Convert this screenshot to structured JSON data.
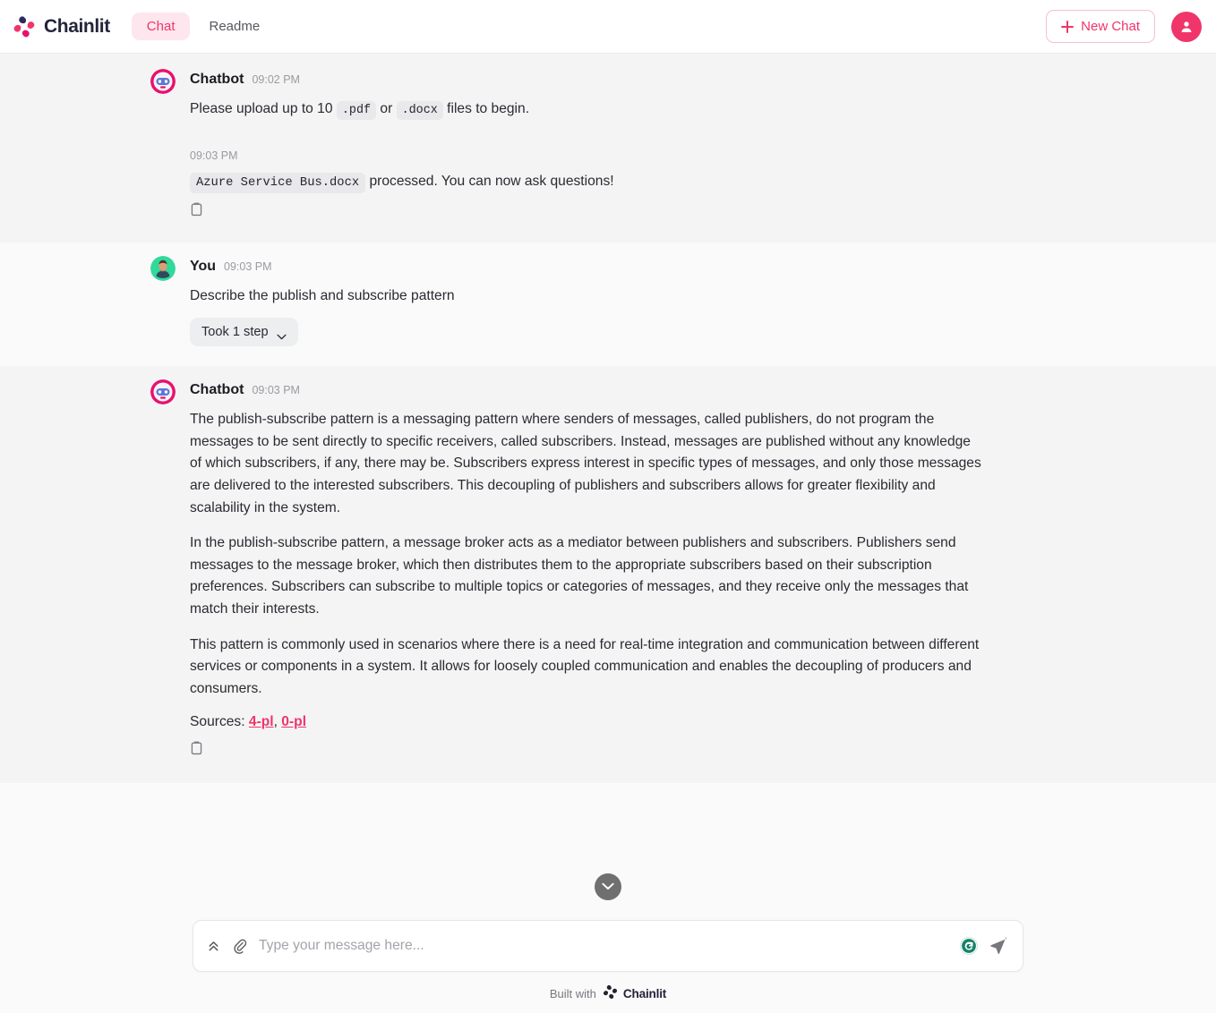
{
  "header": {
    "brand": "Chainlit",
    "brand_mark_icon": "chainlit-logo-icon",
    "nav": [
      {
        "label": "Chat",
        "active": true
      },
      {
        "label": "Readme",
        "active": false
      }
    ],
    "new_chat_label": "New Chat",
    "new_chat_icon": "plus-icon",
    "avatar_icon": "user-avatar-icon",
    "accent_color": "#f0356a",
    "accent_soft_color": "#fde6ee"
  },
  "conversation": {
    "messages": [
      {
        "author": "Chatbot",
        "time": "09:02 PM",
        "avatar_icon": "robot-avatar-icon",
        "text_before": "Please upload up to 10",
        "code_1": ".pdf",
        "text_middle": "or",
        "code_2": ".docx",
        "text_after": "files to begin."
      },
      {
        "sub_time": "09:03 PM",
        "code_file": "Azure Service Bus.docx",
        "text_after": "processed. You can now ask questions!",
        "copy_icon": "copy-icon"
      },
      {
        "author": "You",
        "time": "09:03 PM",
        "avatar_icon": "person-avatar-icon",
        "text": "Describe the publish and subscribe pattern",
        "step_label": "Took 1 step",
        "step_chevron_icon": "chevron-down-icon"
      },
      {
        "author": "Chatbot",
        "time": "09:03 PM",
        "avatar_icon": "robot-avatar-icon",
        "paragraph_1": "The publish-subscribe pattern is a messaging pattern where senders of messages, called publishers, do not program the messages to be sent directly to specific receivers, called subscribers. Instead, messages are published without any knowledge of which subscribers, if any, there may be. Subscribers express interest in specific types of messages, and only those messages are delivered to the interested subscribers. This decoupling of publishers and subscribers allows for greater flexibility and scalability in the system.",
        "paragraph_2": "In the publish-subscribe pattern, a message broker acts as a mediator between publishers and subscribers. Publishers send messages to the message broker, which then distributes them to the appropriate subscribers based on their subscription preferences. Subscribers can subscribe to multiple topics or categories of messages, and they receive only the messages that match their interests.",
        "paragraph_3": "This pattern is commonly used in scenarios where there is a need for real-time integration and communication between different services or components in a system. It allows for loosely coupled communication and enables the decoupling of producers and consumers.",
        "sources_label": "Sources:",
        "sources": [
          "4-pl",
          "0-pl"
        ],
        "sources_separator": ", ",
        "copy_icon": "copy-icon"
      }
    ]
  },
  "composer": {
    "expand_icon": "chevrons-up-icon",
    "attach_icon": "paperclip-icon",
    "placeholder": "Type your message here...",
    "value": "",
    "grammarly_icon": "grammarly-icon",
    "send_icon": "send-icon",
    "scroll_down_icon": "chevron-down-circle-icon"
  },
  "footer": {
    "built_with": "Built with",
    "brand": "Chainlit",
    "logo_icon": "chainlit-logo-icon"
  }
}
